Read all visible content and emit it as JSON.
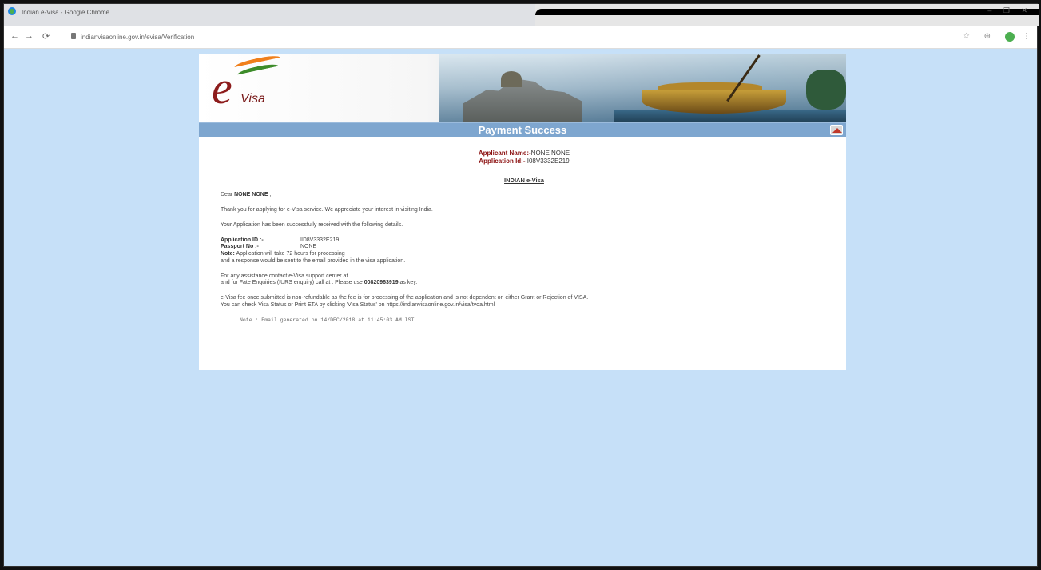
{
  "browser": {
    "window_title": "Indian e-Visa - Google Chrome",
    "url": "indianvisaonline.gov.in/evisa/Verification",
    "win_controls": "–  ❐  ✕"
  },
  "banner": {
    "logo_letter": "e",
    "logo_word": "Visa"
  },
  "section": {
    "title": "Payment Success"
  },
  "applicant": {
    "name_label": "Applicant Name:-",
    "name_value": "NONE NONE",
    "id_label": "Application Id:-",
    "id_value": "II08V3332E219"
  },
  "body": {
    "heading": "INDIAN e-Visa",
    "greeting_prefix": "Dear ",
    "greeting_name": "NONE NONE",
    "greeting_suffix": " ,",
    "para1": "Thank you for applying for e-Visa service. We appreciate your interest in visiting India.",
    "para2": "Your Application has been successfully received with the following details.",
    "app_id_label": "Application ID :-",
    "app_id_value": "II08V3332E219",
    "passport_label": "Passport No :-",
    "passport_value": "NONE",
    "note_label": "Note:",
    "note_text": " Application will take 72 hours for processing",
    "note_text2": "and a response would be sent to the email provided in the visa application.",
    "assist1": "For any assistance contact e-Visa support center at",
    "assist2_prefix": "and for Fate Enquiries (IURS enquiry) call at . Please use ",
    "assist2_key": "00820963919",
    "assist2_suffix": " as key.",
    "fee1": "e-Visa fee once submitted is non-refundable as the fee is for processing of the application and is not dependent on either Grant or Rejection of VISA.",
    "fee2": "You can check Visa Status or Print ETA by clicking 'Visa Status' on https://indianvisaonline.gov.in/visa/tvoa.html",
    "footer": "Note : Email generated on 14/DEC/2018 at 11:45:03 AM IST ."
  }
}
